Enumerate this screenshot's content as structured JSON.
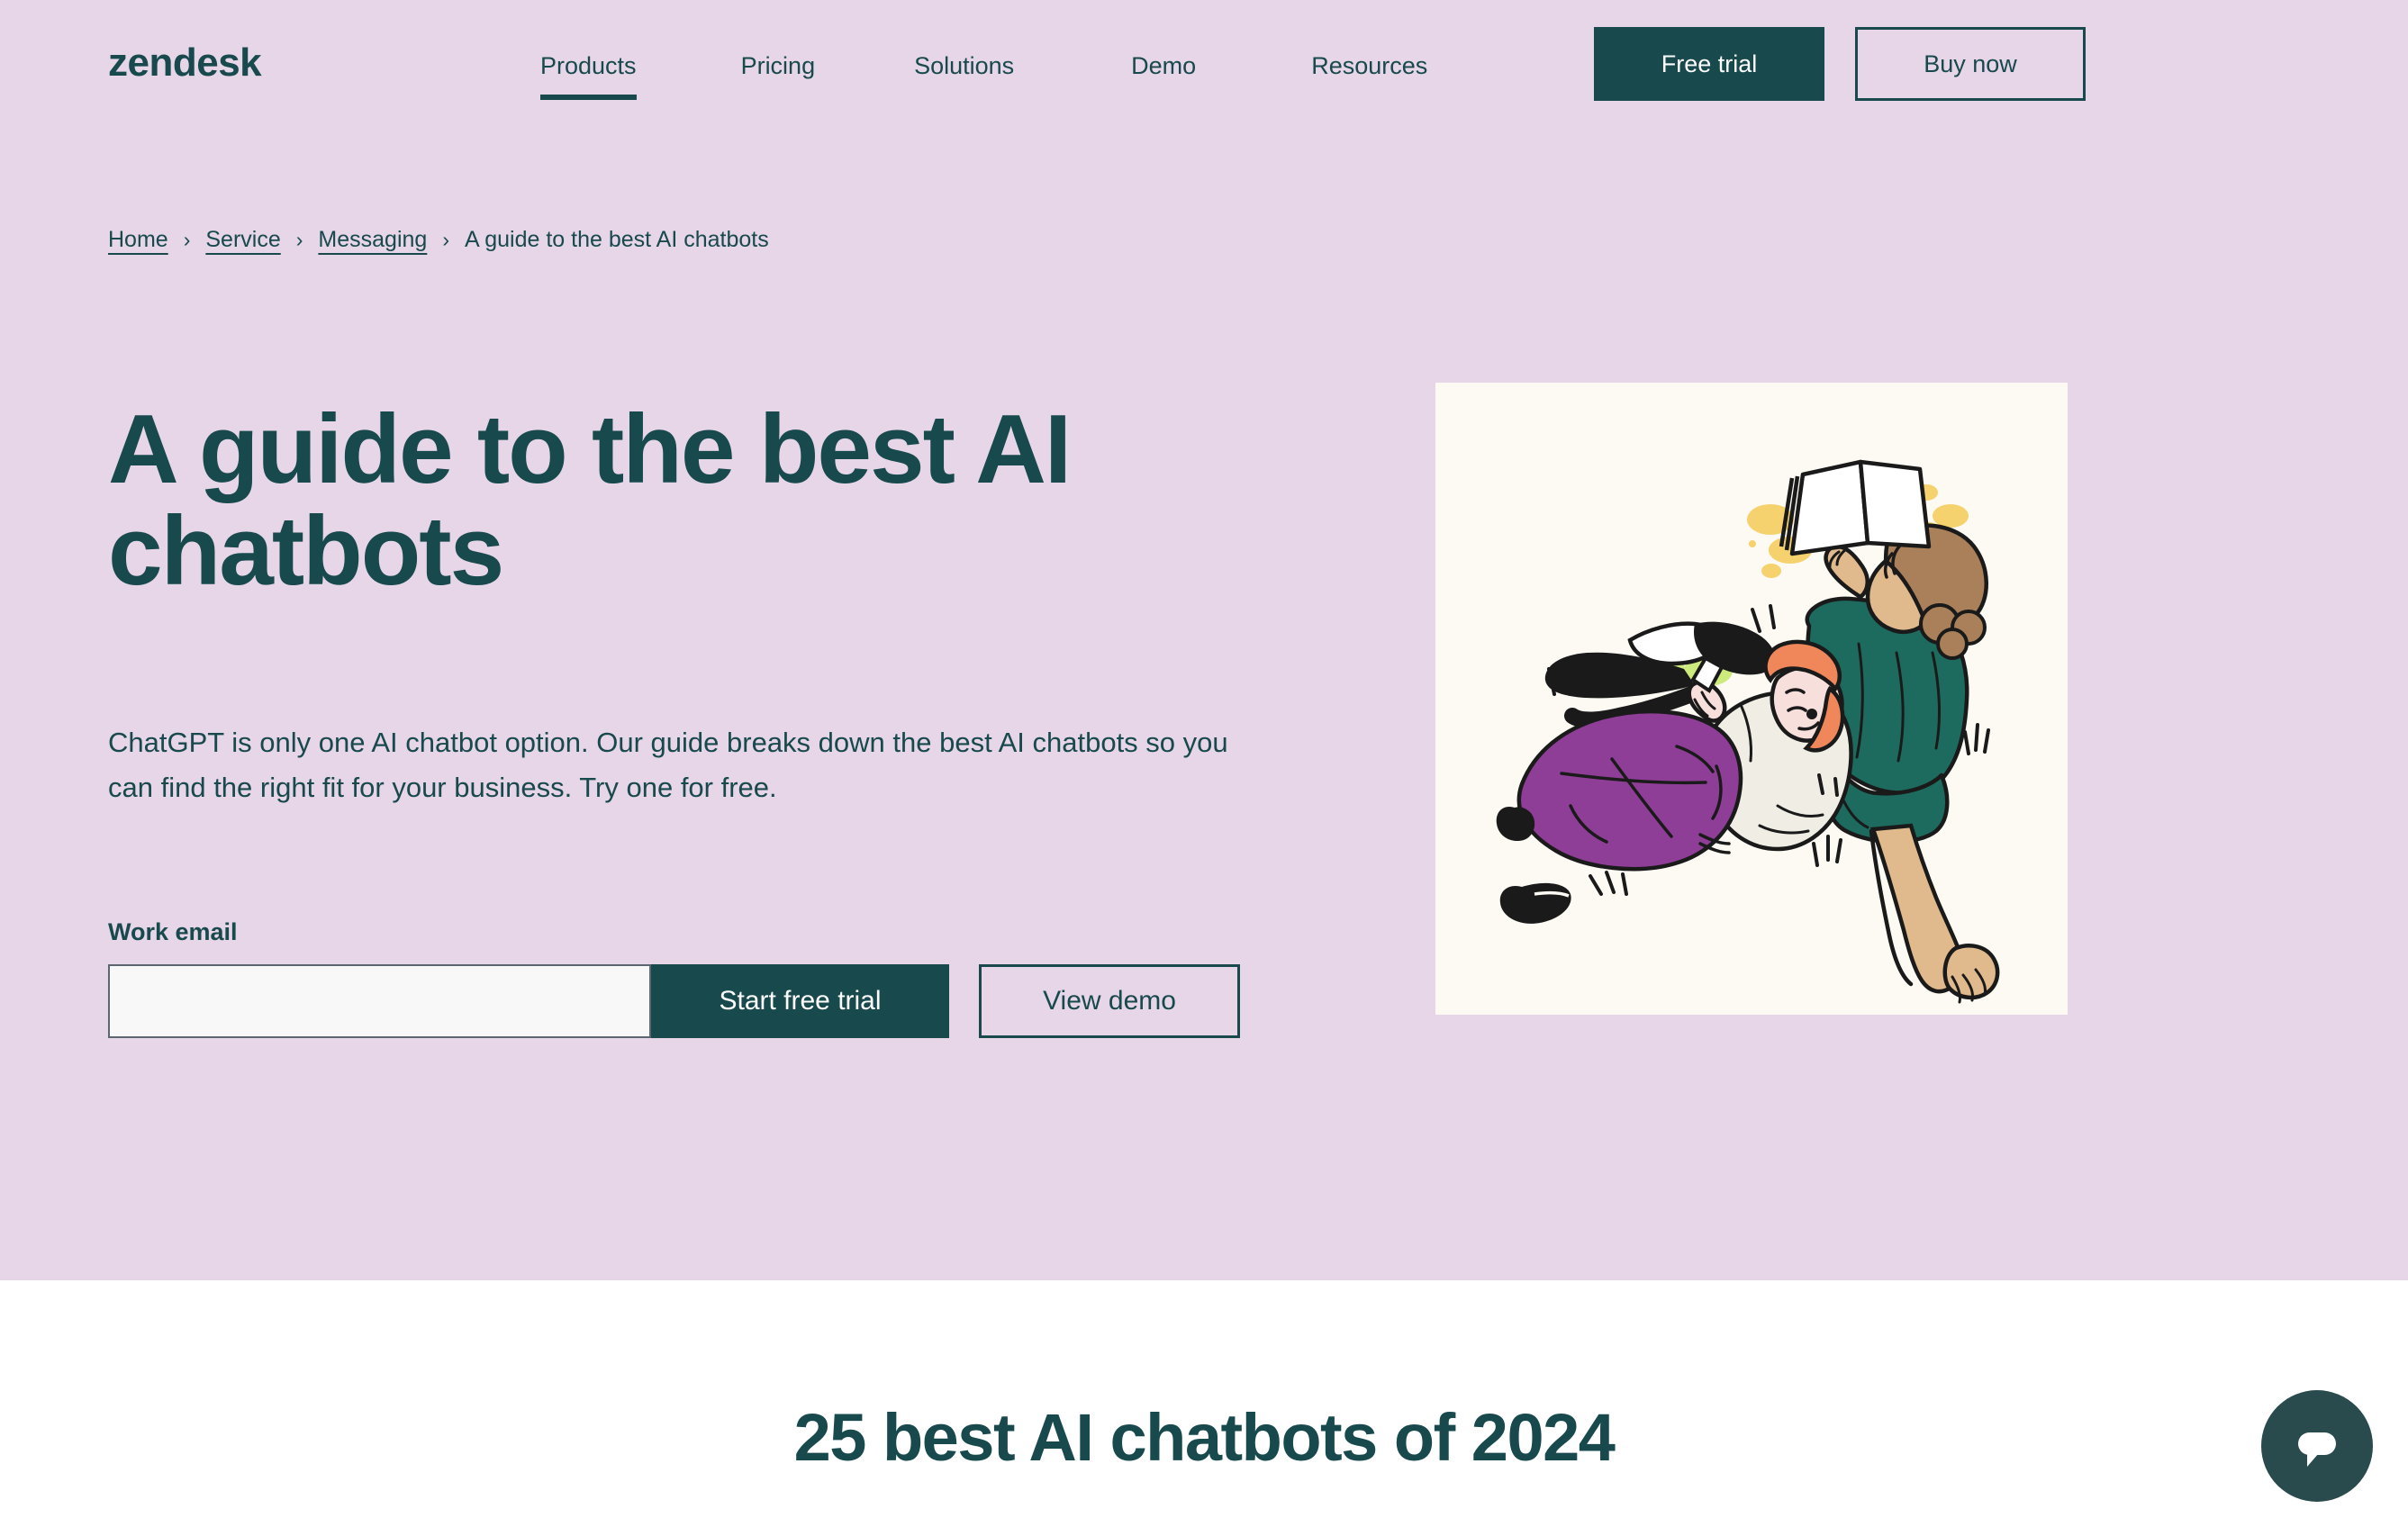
{
  "theme": {
    "hero_bg": "#E7D5E8",
    "brand_dark": "#17494D",
    "page_bg": "#FFFFFF",
    "illustration_bg": "#FDFAF3",
    "input_bg": "#F7F8F7",
    "input_border": "#5C6670",
    "chat_bg": "#2A4B4D"
  },
  "header": {
    "logo_text": "zendesk",
    "nav_items": [
      {
        "label": "Products",
        "active": true
      },
      {
        "label": "Pricing",
        "active": false
      },
      {
        "label": "Solutions",
        "active": false
      },
      {
        "label": "Demo",
        "active": false
      },
      {
        "label": "Resources",
        "active": false
      }
    ],
    "free_trial_label": "Free trial",
    "buy_now_label": "Buy now"
  },
  "breadcrumb": {
    "separator": "›",
    "items": [
      {
        "label": "Home",
        "is_link": true
      },
      {
        "label": "Service",
        "is_link": true
      },
      {
        "label": "Messaging",
        "is_link": true
      },
      {
        "label": "A guide to the best AI chatbots",
        "is_link": false
      }
    ]
  },
  "hero": {
    "title": "A guide to the best AI chatbots",
    "subtitle": "ChatGPT is only one AI chatbot option. Our guide breaks down the best AI chatbots so you can find the right fit for your business. Try one for free.",
    "form": {
      "email_label": "Work email",
      "email_value": "",
      "email_placeholder": "",
      "submit_label": "Start free trial",
      "secondary_label": "View demo"
    },
    "illustration": {
      "alt": "Two people lounging together, one reading a book and one looking at a phone",
      "colors": {
        "background": "#FDFAF3",
        "teal_top": "#1D6B5E",
        "purple_skirt": "#8E3E96",
        "cream_top": "#EFEDE4",
        "skin_light": "#F7DFDC",
        "skin_tan": "#E0B98C",
        "hair_brown": "#A98059",
        "hair_orange": "#F0875B",
        "hair_black": "#1A1A1A",
        "yellow_blob": "#F5D26E",
        "green_blob": "#CDEB7D",
        "ink": "#1A1A1A"
      }
    }
  },
  "section_below": {
    "heading": "25 best AI chatbots of 2024"
  },
  "chat_widget": {
    "icon": "chat-bubble-icon",
    "label": "Open messaging window"
  }
}
